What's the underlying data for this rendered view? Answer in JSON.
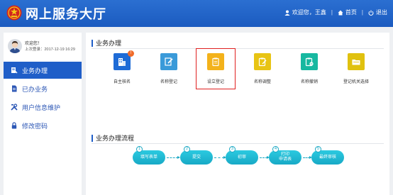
{
  "header": {
    "title": "网上服务大厅",
    "welcome": "欢迎您，王鑫",
    "home": "首页",
    "logout": "退出",
    "colors": {
      "bar": "#1f5ec8"
    }
  },
  "sidebar": {
    "welcome": "欢迎您！",
    "last_login": "上次登录：2017-12-19 16:29",
    "items": [
      {
        "label": "业务办理",
        "icon": "business-icon",
        "active": true
      },
      {
        "label": "已办业务",
        "icon": "document-icon",
        "active": false
      },
      {
        "label": "用户信息维护",
        "icon": "tools-icon",
        "active": false
      },
      {
        "label": "修改密码",
        "icon": "lock-icon",
        "active": false
      }
    ]
  },
  "main": {
    "section1_title": "业务办理",
    "tiles": [
      {
        "label": "自主核名",
        "color": "#1e6bd6",
        "icon": "building-icon",
        "badge": "!"
      },
      {
        "label": "名称登记",
        "color": "#3a9ad9",
        "icon": "pen-edit-icon"
      },
      {
        "label": "设立登记",
        "color": "#f3b21b",
        "icon": "clipboard-icon",
        "selected": true
      },
      {
        "label": "名称调整",
        "color": "#e8c414",
        "icon": "clipboard-edit-icon"
      },
      {
        "label": "名称撤销",
        "color": "#17b8a0",
        "icon": "clipboard-cancel-icon"
      },
      {
        "label": "登记机关选择",
        "color": "#e0c10f",
        "icon": "folder-icon"
      }
    ],
    "section2_title": "业务办理流程",
    "steps": [
      {
        "num": "1",
        "label": "填写表单"
      },
      {
        "num": "2",
        "label": "提交"
      },
      {
        "num": "3",
        "label": "初审"
      },
      {
        "num": "4",
        "label": "打印\n申请表"
      },
      {
        "num": "5",
        "label": "最终审核"
      }
    ]
  }
}
